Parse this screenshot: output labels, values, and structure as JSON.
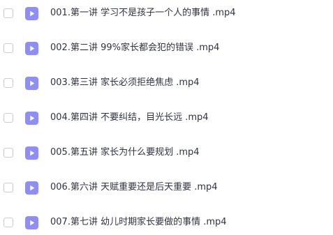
{
  "files": [
    {
      "name": "001.第一讲 学习不是孩子一个人的事情 .mp4",
      "icon": "video-file-icon"
    },
    {
      "name": "002.第二讲 99%家长都会犯的错误 .mp4",
      "icon": "video-file-icon"
    },
    {
      "name": "003.第三讲 家长必须拒绝焦虑 .mp4",
      "icon": "video-file-icon"
    },
    {
      "name": "004.第四讲 不要纠结，目光长远 .mp4",
      "icon": "video-file-icon"
    },
    {
      "name": "005.第五讲 家长为什么要规划 .mp4",
      "icon": "video-file-icon"
    },
    {
      "name": "006.第六讲 天赋重要还是后天重要 .mp4",
      "icon": "video-file-icon"
    },
    {
      "name": "007.第七讲 幼儿时期家长要做的事情 .mp4",
      "icon": "video-file-icon"
    }
  ],
  "colors": {
    "icon_background": "#8f8ff2",
    "text": "#2f3440",
    "checkbox_border": "#c9ccd3"
  }
}
